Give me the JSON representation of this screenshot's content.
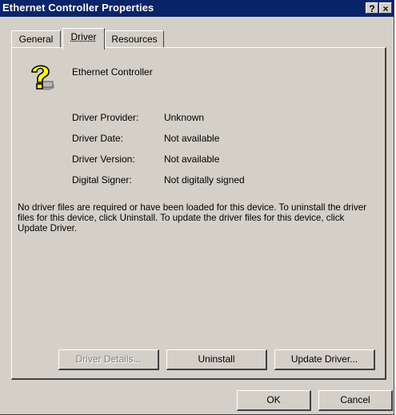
{
  "window": {
    "title": "Ethernet Controller Properties",
    "help_label": "?",
    "close_label": "×"
  },
  "tabs": [
    {
      "label": "General",
      "selected": false
    },
    {
      "label": "Driver",
      "selected": true
    },
    {
      "label": "Resources",
      "selected": false
    }
  ],
  "device": {
    "name": "Ethernet Controller",
    "icon": "unknown-device-question-mark-icon"
  },
  "details": [
    {
      "label": "Driver Provider:",
      "value": "Unknown"
    },
    {
      "label": "Driver Date:",
      "value": "Not available"
    },
    {
      "label": "Driver Version:",
      "value": "Not available"
    },
    {
      "label": "Digital Signer:",
      "value": "Not digitally signed"
    }
  ],
  "message": "No driver files are required or have been loaded for this device. To uninstall the driver files for this device, click Uninstall. To update the driver files for this device, click Update Driver.",
  "buttons": {
    "driver_details": {
      "label": "Driver Details...",
      "enabled": false
    },
    "uninstall": {
      "label": "Uninstall",
      "enabled": true
    },
    "update_driver": {
      "label": "Update Driver...",
      "enabled": true
    },
    "ok": {
      "label": "OK",
      "enabled": true
    },
    "cancel": {
      "label": "Cancel",
      "enabled": true
    }
  },
  "colors": {
    "titlebar": "#0a246a",
    "dialog_face": "#d4d0c8",
    "icon_yellow": "#ffff00"
  }
}
